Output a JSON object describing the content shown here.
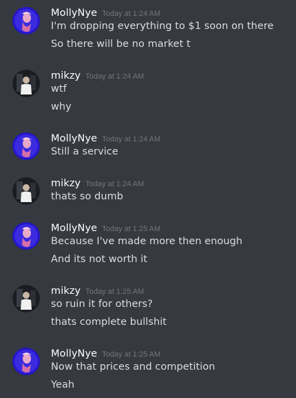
{
  "colors": {
    "background": "#36393f",
    "username": "#ffffff",
    "message_text": "#dcddde",
    "timestamp": "#72767d",
    "molly_avatar_bg": "#2316c8",
    "mikzy_avatar_bg": "#1c1d22"
  },
  "messages": [
    {
      "username": "MollyNye",
      "timestamp": "Today at 1:24 AM",
      "avatar_icon": "molly-avatar-icon",
      "lines": [
        "I'm dropping everything to $1 soon on there",
        "So there will be no market t"
      ]
    },
    {
      "username": "mikzy",
      "timestamp": "Today at 1:24 AM",
      "avatar_icon": "mikzy-avatar-icon",
      "lines": [
        "wtf",
        "why"
      ]
    },
    {
      "username": "MollyNye",
      "timestamp": "Today at 1:24 AM",
      "avatar_icon": "molly-avatar-icon",
      "lines": [
        "Still a service"
      ]
    },
    {
      "username": "mikzy",
      "timestamp": "Today at 1:24 AM",
      "avatar_icon": "mikzy-avatar-icon",
      "lines": [
        "thats so dumb"
      ]
    },
    {
      "username": "MollyNye",
      "timestamp": "Today at 1:25 AM",
      "avatar_icon": "molly-avatar-icon",
      "lines": [
        "Because I've made more then enough",
        "And its not worth it"
      ]
    },
    {
      "username": "mikzy",
      "timestamp": "Today at 1:25 AM",
      "avatar_icon": "mikzy-avatar-icon",
      "lines": [
        "so ruin it for others?",
        "thats complete bullshit"
      ]
    },
    {
      "username": "MollyNye",
      "timestamp": "Today at 1:25 AM",
      "avatar_icon": "molly-avatar-icon",
      "lines": [
        "Now that prices and competition",
        "Yeah"
      ]
    }
  ]
}
